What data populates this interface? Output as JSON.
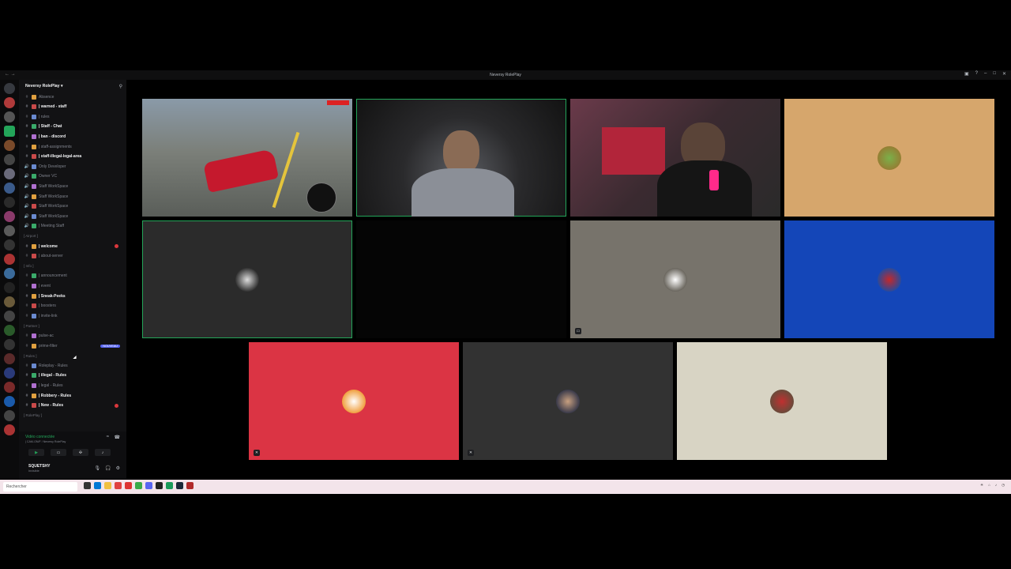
{
  "window": {
    "title": "Neversy RolePlay"
  },
  "server": {
    "name": "Neversy RolePlay ▾"
  },
  "channels": [
    {
      "label": "Absence",
      "bold": false,
      "type": "text"
    },
    {
      "label": "| warned - staff",
      "bold": true,
      "type": "text"
    },
    {
      "label": "| rules",
      "bold": false,
      "type": "text"
    },
    {
      "label": "| Staff - Chat",
      "bold": true,
      "type": "text"
    },
    {
      "label": "| ban - discord",
      "bold": true,
      "type": "text"
    },
    {
      "label": "| staff-assignments",
      "bold": false,
      "type": "text"
    },
    {
      "label": "| staff-illegal-legal-area",
      "bold": true,
      "type": "text"
    },
    {
      "label": "Only Developer",
      "bold": false,
      "type": "voice"
    },
    {
      "label": "Owner VC",
      "bold": false,
      "type": "voice"
    },
    {
      "label": "Staff WorkSpace",
      "bold": false,
      "type": "voice"
    },
    {
      "label": "Staff WorkSpace",
      "bold": false,
      "type": "voice"
    },
    {
      "label": "Staff WorkSpace",
      "bold": false,
      "type": "voice"
    },
    {
      "label": "Staff WorkSpace",
      "bold": false,
      "type": "voice"
    },
    {
      "label": "| Meeting Staff",
      "bold": false,
      "type": "voice"
    },
    {
      "label": "[ Airport ]",
      "bold": false,
      "type": "category"
    },
    {
      "label": "| welcome",
      "bold": true,
      "type": "text"
    },
    {
      "label": "| about-server",
      "bold": false,
      "type": "text"
    },
    {
      "label": "[ Info ]",
      "bold": false,
      "type": "category"
    },
    {
      "label": "| announcement",
      "bold": false,
      "type": "text"
    },
    {
      "label": "| event",
      "bold": false,
      "type": "text"
    },
    {
      "label": "| Sneak-Peeks",
      "bold": true,
      "type": "text"
    },
    {
      "label": "| boosters",
      "bold": false,
      "type": "text"
    },
    {
      "label": "| invite-link",
      "bold": false,
      "type": "text"
    },
    {
      "label": "[ Partner ]",
      "bold": false,
      "type": "category"
    },
    {
      "label": "pulse-ac",
      "bold": false,
      "type": "text"
    },
    {
      "label": "prime-filter",
      "bold": false,
      "type": "text"
    },
    {
      "label": "[ Rules ]",
      "bold": false,
      "type": "category"
    },
    {
      "label": "Roleplay - Rules",
      "bold": false,
      "type": "text"
    },
    {
      "label": "| illegal - Rules",
      "bold": true,
      "type": "text"
    },
    {
      "label": "| legal - Rules",
      "bold": false,
      "type": "text"
    },
    {
      "label": "| Robbery - Rules",
      "bold": true,
      "type": "text"
    },
    {
      "label": "| New - Rules",
      "bold": true,
      "type": "text"
    },
    {
      "label": "[ RolePlay ]",
      "bold": false,
      "type": "category"
    }
  ],
  "badges": {
    "nouveau": "NOUVEAU"
  },
  "voice": {
    "status": "Vidéo connectée",
    "channel": "| CAM-ON/F / Neversy RolePlay"
  },
  "user": {
    "name": "SQUETSHY",
    "status": "Invisible"
  },
  "colors": {
    "accent": "#5865f2",
    "online": "#23a559",
    "danger": "#da373c"
  },
  "taskbar": {
    "search": "Rechercher"
  }
}
